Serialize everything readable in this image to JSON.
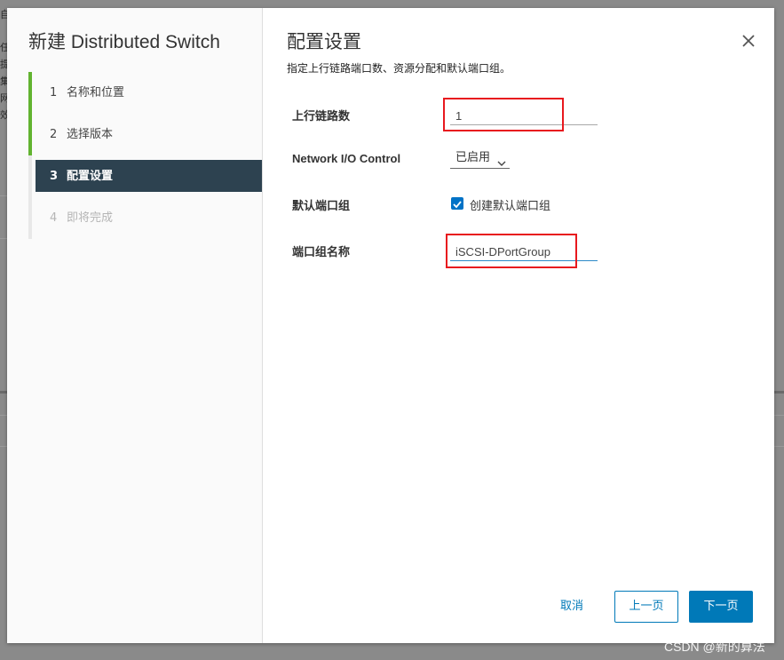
{
  "background": {
    "fragment_chars": [
      "自",
      "任",
      "提",
      "集",
      "网",
      "效"
    ]
  },
  "wizard": {
    "title": "新建 Distributed Switch",
    "steps": [
      {
        "num": "1",
        "label": "名称和位置",
        "state": "done"
      },
      {
        "num": "2",
        "label": "选择版本",
        "state": "done"
      },
      {
        "num": "3",
        "label": "配置设置",
        "state": "active"
      },
      {
        "num": "4",
        "label": "即将完成",
        "state": "disabled"
      }
    ]
  },
  "page": {
    "title": "配置设置",
    "description": "指定上行链路端口数、资源分配和默认端口组。",
    "close_icon": "close-icon"
  },
  "form": {
    "uplinks_label": "上行链路数",
    "uplinks_value": "1",
    "nioc_label": "Network I/O Control",
    "nioc_value": "已启用",
    "default_pg_label": "默认端口组",
    "create_default_pg_label": "创建默认端口组",
    "create_default_pg_checked": true,
    "pg_name_label": "端口组名称",
    "pg_name_value": "iSCSI-DPortGroup"
  },
  "footer": {
    "cancel_label": "取消",
    "back_label": "上一页",
    "next_label": "下一页"
  },
  "colors": {
    "done": "#62b330",
    "active_bg": "#2d4250",
    "primary": "#0079b8",
    "highlight_box": "#e8181e"
  },
  "watermark": "CSDN @新的算法"
}
